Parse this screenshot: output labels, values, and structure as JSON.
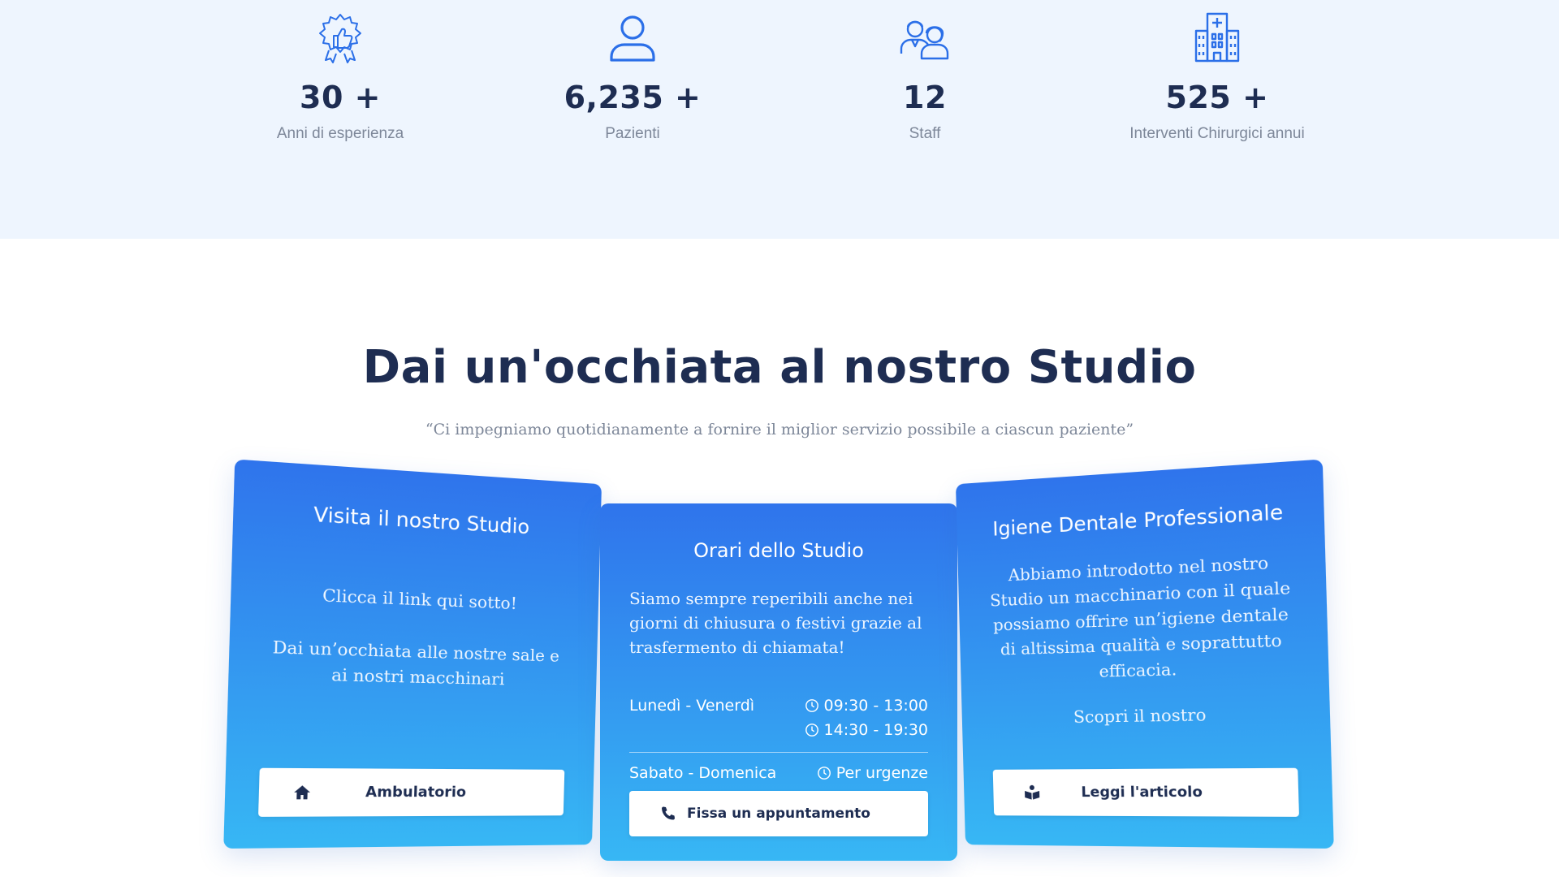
{
  "stats": [
    {
      "icon": "thumbs-up-badge-icon",
      "value": "30 +",
      "label": "Anni di esperienza"
    },
    {
      "icon": "user-icon",
      "value": "6,235 +",
      "label": "Pazienti"
    },
    {
      "icon": "staff-icon",
      "value": "12",
      "label": "Staff"
    },
    {
      "icon": "hospital-icon",
      "value": "525 +",
      "label": "Interventi Chirurgici annui"
    }
  ],
  "section": {
    "title": "Dai un'occhiata al nostro Studio",
    "quote": "“Ci impegniamo quotidianamente a fornire il miglior servizio possibile a ciascun paziente”"
  },
  "cards": {
    "visit": {
      "title": "Visita il nostro Studio",
      "text1": "Clicca il link qui sotto!",
      "text2": "Dai un’occhiata alle nostre sale e ai nostri macchinari",
      "button_icon": "home-icon",
      "button_label": "Ambulatorio"
    },
    "hours": {
      "title": "Orari dello Studio",
      "text": "Siamo sempre reperibili anche nei giorni di chiusura o festivi grazie al trasfermento di chiamata!",
      "weekday_label": "Lunedì - Venerdì",
      "weekday_morning": "09:30 - 13:00",
      "weekday_afternoon": "14:30 - 19:30",
      "weekend_label": "Sabato - Domenica",
      "weekend_value": "Per urgenze",
      "button_icon": "phone-icon",
      "button_label": "Fissa un appuntamento"
    },
    "hygiene": {
      "title": "Igiene Dentale Professionale",
      "text1": "Abbiamo introdotto nel nostro Studio un macchinario con il quale possiamo offrire un’igiene dentale di altissima qualità e soprattutto efficacia.",
      "text2": "Scopri il nostro",
      "button_icon": "book-reader-icon",
      "button_label": "Leggi l'articolo"
    }
  },
  "colors": {
    "band_bg": "#eef5fe",
    "heading": "#1e2d52",
    "muted": "#7d8799",
    "icon_blue": "#2b6fe8",
    "card_gradient_top": "#2f74ec",
    "card_gradient_bottom": "#37b7f4"
  }
}
